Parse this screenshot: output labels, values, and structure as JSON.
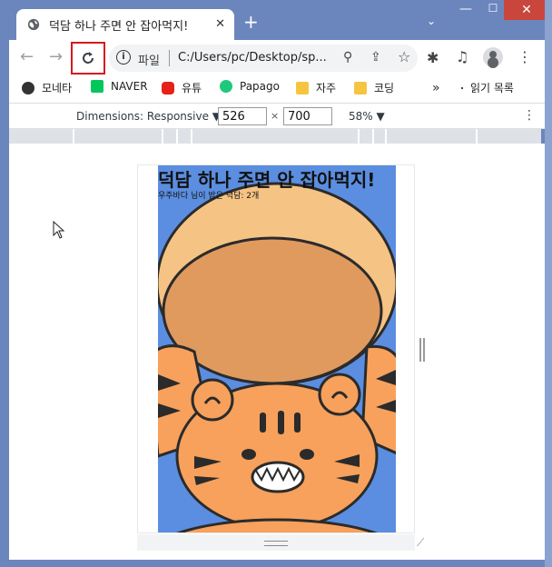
{
  "tab": {
    "title": "덕담 하나 주면 안 잡아먹지!",
    "close": "✕",
    "new_tab": "+"
  },
  "window": {
    "minimize": "—",
    "maximize": "☐",
    "close": "✕",
    "dropdown": "⌄"
  },
  "omnibox": {
    "scheme": "파일",
    "url": "C:/Users/pc/Desktop/sp..."
  },
  "bookmarks": [
    {
      "label": "모네타",
      "color": "#333333"
    },
    {
      "label": "NAVER",
      "color": "#03c75a"
    },
    {
      "label": "유튜",
      "color": "#e62117"
    },
    {
      "label": "Papago",
      "color": "#1ec97b"
    },
    {
      "label": "자주",
      "color": "#f5c542"
    },
    {
      "label": "코딩",
      "color": "#f5c542"
    }
  ],
  "bookmarks_more": "»",
  "reading_list": "읽기 목록",
  "devtools": {
    "dimensions_label": "Dimensions: Responsive ▼",
    "width": "526",
    "height": "700",
    "times": "×",
    "zoom": "58% ▼"
  },
  "page": {
    "title": "덕담 하나 주면 안 잡아먹지!",
    "subtitle": "우주바다 님이 받은 덕담: 2개"
  },
  "colors": {
    "poster_bg": "#5b8ee0",
    "tiger_orange": "#f7a15c",
    "cap_tan": "#e09a5e",
    "cap_light": "#f5c384",
    "accent_red": "#d7191c"
  }
}
